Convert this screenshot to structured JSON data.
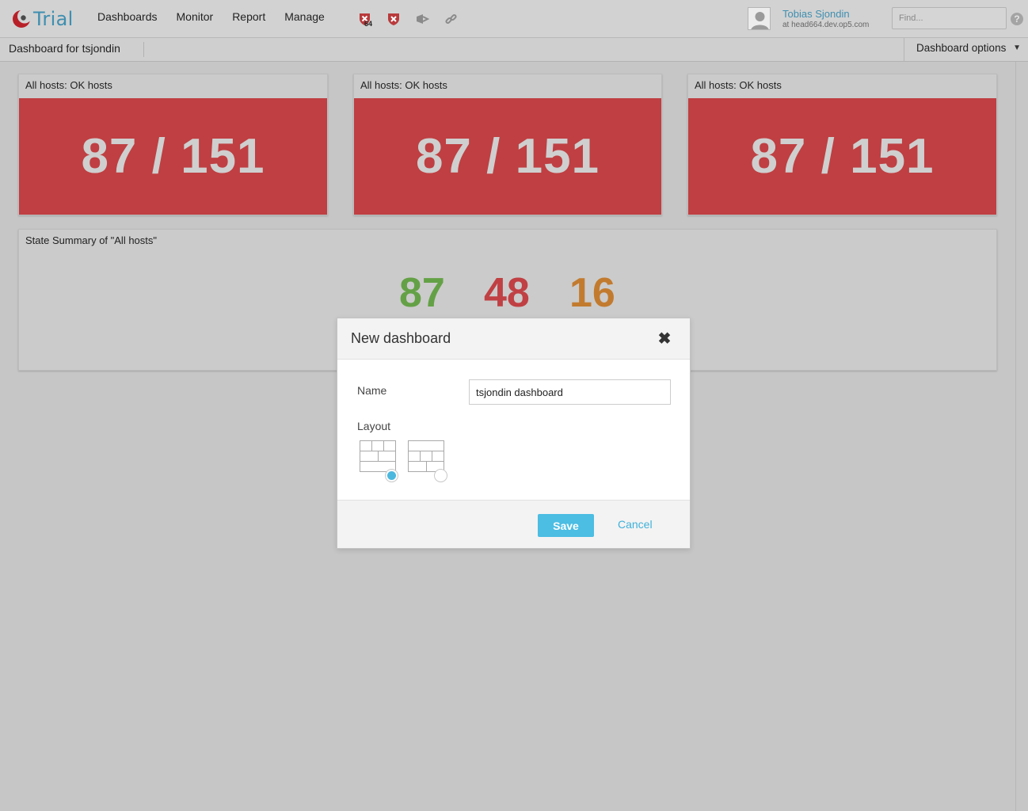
{
  "app": {
    "logo_text": "Trial"
  },
  "nav": {
    "items": [
      "Dashboards",
      "Monitor",
      "Report",
      "Manage"
    ]
  },
  "status_icons": [
    {
      "name": "host-problem-icon",
      "badge": "64"
    },
    {
      "name": "service-problem-icon"
    },
    {
      "name": "notification-icon"
    },
    {
      "name": "link-icon"
    }
  ],
  "user": {
    "name": "Tobias Sjondin",
    "host": "at head664.dev.op5.com"
  },
  "search": {
    "placeholder": "Find..."
  },
  "help_glyph": "?",
  "subbar": {
    "title": "Dashboard for tsjondin",
    "options_label": "Dashboard options",
    "options_arrow": "▼"
  },
  "widgets": [
    {
      "title": "All hosts: OK hosts",
      "value": "87 / 151"
    },
    {
      "title": "All hosts: OK hosts",
      "value": "87 / 151"
    },
    {
      "title": "All hosts: OK hosts",
      "value": "87 / 151"
    }
  ],
  "summary": {
    "title": "State Summary of \"All hosts\"",
    "ok": "87",
    "down": "48",
    "unreachable": "16"
  },
  "modal": {
    "title": "New dashboard",
    "close_glyph": "✖",
    "name_label": "Name",
    "name_value": "tsjondin dashboard",
    "layout_label": "Layout",
    "selected_layout": 1,
    "save_label": "Save",
    "cancel_label": "Cancel"
  },
  "colors": {
    "accent": "#4cbde3",
    "link": "#3f8fb0",
    "critical": "#bf3f42",
    "ok": "#64a146",
    "warning": "#c27b2e"
  }
}
